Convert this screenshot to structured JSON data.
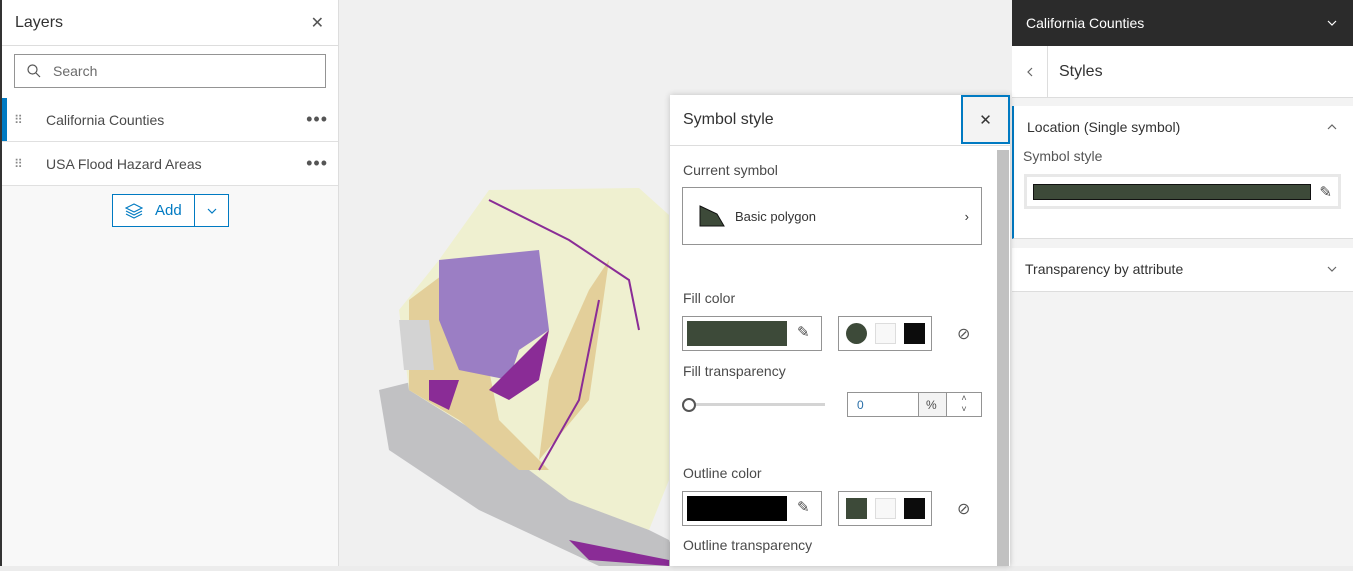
{
  "layers_panel": {
    "title": "Layers",
    "search_placeholder": "Search",
    "items": [
      {
        "label": "California Counties",
        "selected": true
      },
      {
        "label": "USA Flood Hazard Areas",
        "selected": false
      }
    ],
    "add_label": "Add"
  },
  "right_panel": {
    "layer_title": "California Counties",
    "subtitle": "Styles",
    "section1": "Location (Single symbol)",
    "symbol_style_label": "Symbol style",
    "section2": "Transparency by attribute"
  },
  "symbol_dialog": {
    "title": "Symbol style",
    "current_symbol_label": "Current symbol",
    "current_symbol": "Basic polygon",
    "fill_color_label": "Fill color",
    "fill_color": "#3d4a39",
    "fill_transparency_label": "Fill transparency",
    "fill_transparency": "0",
    "unit": "%",
    "outline_color_label": "Outline color",
    "outline_color": "#000000",
    "outline_transparency_label": "Outline transparency",
    "swatches": [
      "#3d4a39",
      "#f8f8f8",
      "#0c0c0c"
    ]
  },
  "colors": {
    "accent": "#007ac2",
    "header": "#2b2b2b"
  }
}
